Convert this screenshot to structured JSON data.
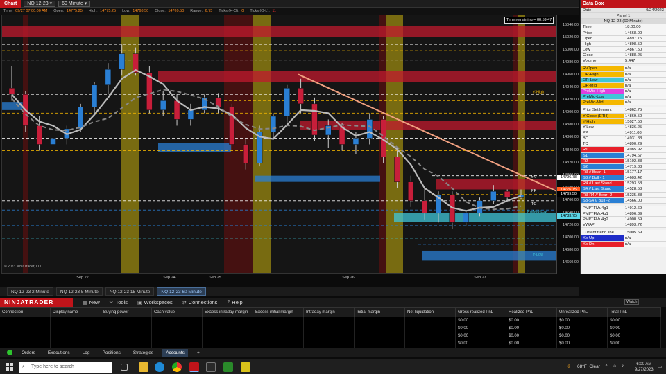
{
  "chart": {
    "window_label": "Chart",
    "instrument": "NQ 12-23",
    "interval": "60 Minute",
    "info": {
      "time_label": "Time",
      "time_value": "09/27 07:00:00 AM",
      "open_label": "Open",
      "open_value": "14775.25",
      "high_label": "High",
      "high_value": "14775.25",
      "low_label": "Low",
      "low_value": "14768.50",
      "close_label": "Close",
      "close_value": "14769.50",
      "range_label": "Range",
      "range_value": "6.75",
      "ticks_hl_label": "Ticks (H-O)",
      "ticks_hl_value": "0",
      "ticks_ol_label": "Ticks (O-L)",
      "ticks_ol_value": "11"
    },
    "time_remaining": "Time remaining = 00:59:47",
    "copyright": "© 2023 NinjaTrader, LLC",
    "overlay_labels": {
      "y_high": "Y-High",
      "bc": "BC",
      "pp": "PP",
      "tc": "TC",
      "prmid_low": "PreMid-Low",
      "y_low": "Y-Low"
    }
  },
  "chart_data": {
    "type": "candlestick",
    "title": "NQ 12-23 (60 Minute)",
    "ylim": [
      14660,
      15050
    ],
    "y_ticks": [
      15040,
      15020,
      15000,
      14980,
      14960,
      14940,
      14920,
      14900,
      14880,
      14860,
      14840,
      14820,
      14800,
      14780,
      14760,
      14740,
      14720,
      14700,
      14680,
      14660
    ],
    "y_tick_labels": [
      "15040.00",
      "15020.00",
      "15000.00",
      "14980.00",
      "14960.00",
      "14940.00",
      "14920.00",
      "14900.00",
      "14880.00",
      "14860.00",
      "14840.00",
      "14820.00",
      "14800.00",
      "14780.00",
      "14760.00",
      "14740.00",
      "14720.00",
      "14700.00",
      "14680.00",
      "14660.00"
    ],
    "x_ticks": [
      "Sep 22",
      "Sep 24",
      "Sep 25",
      "Sep 26",
      "Sep 27"
    ],
    "price_tags": [
      {
        "label": "14796.78",
        "value": 14796.78,
        "color": "#ffffff",
        "text": "#000000"
      },
      {
        "label": "14776.75",
        "value": 14776.75,
        "color": "#ff5a1f",
        "text": "#ffffff"
      },
      {
        "label": "14769.50",
        "value": 14769.5,
        "color": "#000000",
        "text": "#ffffff"
      },
      {
        "label": "14733.75",
        "value": 14733.75,
        "color": "#5bd6e8",
        "text": "#000000"
      }
    ],
    "zones": [
      {
        "name": "supply-top",
        "from": 15022,
        "to": 15040,
        "color": "#c01a2e"
      },
      {
        "name": "upper-supply",
        "from": 14950,
        "to": 14968,
        "color": "#c01a2e"
      },
      {
        "name": "mid-supply",
        "from": 14873,
        "to": 14888,
        "color": "#c01a2e"
      },
      {
        "name": "r-zone",
        "from": 14778,
        "to": 14794,
        "color": "#c01a2e"
      },
      {
        "name": "s-zone-blue",
        "from": 14664,
        "to": 14680,
        "color": "#2a7fd4"
      },
      {
        "name": "demand-blue-1",
        "from": 14905,
        "to": 14918,
        "color": "#2a7fd4"
      },
      {
        "name": "demand-blue-2",
        "from": 14838,
        "to": 14852,
        "color": "#2a7fd4"
      },
      {
        "name": "demand-blue-3",
        "from": 14790,
        "to": 14800,
        "color": "#2a7fd4"
      },
      {
        "name": "demand-cyan",
        "from": 14726,
        "to": 14740,
        "color": "#3fc6d8"
      }
    ],
    "session_bands_x_days": [
      0.4,
      2.4,
      3.4,
      4.7
    ],
    "series": [
      {
        "name": "Price",
        "candles": [
          [
            14940,
            14975,
            14920,
            14930
          ],
          [
            14930,
            14935,
            14870,
            14880
          ],
          [
            14880,
            14895,
            14840,
            14850
          ],
          [
            14850,
            14870,
            14835,
            14860
          ],
          [
            14860,
            14880,
            14850,
            14875
          ],
          [
            14875,
            14915,
            14870,
            14910
          ],
          [
            14910,
            14950,
            14900,
            14945
          ],
          [
            14945,
            14980,
            14930,
            14970
          ],
          [
            14970,
            15010,
            14960,
            14995
          ],
          [
            14995,
            15005,
            14960,
            14965
          ],
          [
            14965,
            14975,
            14900,
            14905
          ],
          [
            14905,
            14935,
            14895,
            14920
          ],
          [
            14920,
            14930,
            14880,
            14890
          ],
          [
            14890,
            14915,
            14880,
            14905
          ],
          [
            14905,
            14930,
            14900,
            14925
          ],
          [
            14925,
            14932,
            14900,
            14910
          ],
          [
            14910,
            14915,
            14840,
            14850
          ],
          [
            14850,
            14860,
            14810,
            14820
          ],
          [
            14820,
            14880,
            14815,
            14870
          ],
          [
            14870,
            14900,
            14860,
            14895
          ],
          [
            14895,
            14945,
            14885,
            14940
          ],
          [
            14940,
            14955,
            14900,
            14915
          ],
          [
            14915,
            14925,
            14855,
            14865
          ],
          [
            14865,
            14890,
            14845,
            14880
          ],
          [
            14880,
            14885,
            14840,
            14850
          ],
          [
            14850,
            14870,
            14835,
            14860
          ],
          [
            14860,
            14900,
            14850,
            14890
          ],
          [
            14890,
            14895,
            14820,
            14830
          ],
          [
            14830,
            14840,
            14780,
            14790
          ],
          [
            14790,
            14800,
            14750,
            14760
          ],
          [
            14760,
            14780,
            14730,
            14740
          ],
          [
            14740,
            14775,
            14725,
            14770
          ],
          [
            14770,
            14775,
            14715,
            14725
          ],
          [
            14725,
            14745,
            14720,
            14740
          ],
          [
            14740,
            14765,
            14735,
            14760
          ],
          [
            14760,
            14785,
            14755,
            14775
          ],
          [
            14775,
            14778,
            14760,
            14765
          ],
          [
            14765,
            14778,
            14762,
            14769.5
          ]
        ]
      }
    ]
  },
  "databox": {
    "title": "Data Box",
    "date_label": "Date",
    "date_value": "9/24/2023",
    "panel": "Panel 1",
    "instrument_header": "NQ 12-23 (60 Minute)",
    "rows_ohlc": [
      {
        "k": "Time",
        "v": "18:00:00"
      },
      {
        "k": "Price",
        "v": "14668.00"
      },
      {
        "k": "Open",
        "v": "14897.75"
      },
      {
        "k": "High",
        "v": "14898.50"
      },
      {
        "k": "Low",
        "v": "14867.50"
      },
      {
        "k": "Close",
        "v": "14888.25"
      },
      {
        "k": "Volume",
        "v": "5,447"
      }
    ],
    "rows_or": [
      {
        "k": "R-Open",
        "v": "n/a",
        "c": "#f5b800"
      },
      {
        "k": "OR-High",
        "v": "n/a",
        "c": "#f5b800"
      },
      {
        "k": "OR-Low",
        "v": "n/a",
        "c": "#3fc6d8"
      },
      {
        "k": "OR-Mid",
        "v": "n/a",
        "c": "#f5b800"
      },
      {
        "k": "PreMid-High",
        "v": "n/a",
        "c": "#e040e0"
      },
      {
        "k": "PreMid-Low",
        "v": "n/a",
        "c": "#3fc6d8"
      },
      {
        "k": "PreMid-Mid",
        "v": "n/a",
        "c": "#f5b800"
      }
    ],
    "rows_levels": [
      {
        "k": "Prior Settlement",
        "v": "14862.75",
        "c": "#f5f5f5"
      },
      {
        "k": "Y-Close (ETH)",
        "v": "14869.50",
        "c": "#f5b800"
      },
      {
        "k": "Y-High",
        "v": "15027.50",
        "c": "#f5b800"
      },
      {
        "k": "Y-Low",
        "v": "14836.25",
        "c": "#f5f5f5"
      },
      {
        "k": "PP",
        "v": "14911.08",
        "c": "#f5f5f5"
      },
      {
        "k": "BC",
        "v": "14931.88",
        "c": "#f5f5f5"
      },
      {
        "k": "TC",
        "v": "14890.29",
        "c": "#f5f5f5"
      },
      {
        "k": "R1",
        "v": "14985.92",
        "c": "#e8202a"
      },
      {
        "k": "S1",
        "v": "14794.67",
        "c": "#2a7fd4"
      },
      {
        "k": "R2",
        "v": "15102.33",
        "c": "#e8202a"
      },
      {
        "k": "S2",
        "v": "14719.83",
        "c": "#2a7fd4"
      },
      {
        "k": "R3 // Bear -1",
        "v": "15177.17",
        "c": "#e8202a"
      },
      {
        "k": "S3 // Bull - 1",
        "v": "14603.42",
        "c": "#2a7fd4"
      },
      {
        "k": "R4 // Last Stand",
        "v": "15293.58",
        "c": "#e8202a"
      },
      {
        "k": "S4 // Last Stand",
        "v": "14528.58",
        "c": "#2a7fd4"
      },
      {
        "k": "R3-R4 // Bear -2",
        "v": "15235.38",
        "c": "#e8202a"
      },
      {
        "k": "S3-S4 // Bull -2",
        "v": "14566.00",
        "c": "#2a7fd4"
      }
    ],
    "rows_misc": [
      {
        "k": "PMI/TFMu4g1",
        "v": "14912.69",
        "c": "#f5f5f5"
      },
      {
        "k": "PMI/TFMu4g1",
        "v": "14896.39",
        "c": "#f5f5f5"
      },
      {
        "k": "PMI/TFMu4g2",
        "v": "14900.59",
        "c": "#f5f5f5"
      },
      {
        "k": "VWAP",
        "v": "14893.72",
        "c": "#f5f5f5"
      }
    ],
    "rows_trend": [
      {
        "k": "Current trend line",
        "v": "15005.69",
        "c": "#f5f5f5"
      },
      {
        "k": "Xo-Up",
        "v": "n/a",
        "c": "#1e2cc8"
      },
      {
        "k": "Xo-Dn",
        "v": "n/a",
        "c": "#e8202a"
      }
    ]
  },
  "chart_tabs": [
    "NQ 12-23 2 Minute",
    "NQ 12-23 5 Minute",
    "NQ 12-23 15 Minute",
    "NQ 12-23 60 Minute"
  ],
  "control_center": {
    "logo": "NINJATRADER",
    "menu": [
      {
        "label": "New",
        "icon": "▦"
      },
      {
        "label": "Tools",
        "icon": "✂"
      },
      {
        "label": "Workspaces",
        "icon": "▣"
      },
      {
        "label": "Connections",
        "icon": "⇄"
      },
      {
        "label": "Help",
        "icon": "?"
      }
    ],
    "watch": "Watch",
    "grid_headers": [
      "Connection",
      "Display name",
      "Buying power",
      "Cash value",
      "Excess intraday margin",
      "Excess initial margin",
      "Intraday margin",
      "Initial margin",
      "Net liquidation",
      "Gross realized PnL",
      "Realized PnL",
      "Unrealized PnL",
      "Total PnL"
    ],
    "grid_rows": [
      [
        "",
        "",
        "",
        "",
        "",
        "",
        "",
        "",
        "",
        "$0.00",
        "$0.00",
        "$0.00",
        "$0.00"
      ],
      [
        "",
        "",
        "",
        "",
        "",
        "",
        "",
        "",
        "",
        "$0.00",
        "$0.00",
        "$0.00",
        "$0.00"
      ],
      [
        "",
        "",
        "",
        "",
        "",
        "",
        "",
        "",
        "",
        "$0.00",
        "$0.00",
        "$0.00",
        "$0.00"
      ],
      [
        "",
        "",
        "",
        "",
        "",
        "",
        "",
        "",
        "",
        "$0.00",
        "$0.00",
        "$0.00",
        "$0.00"
      ]
    ],
    "bottom_tabs": [
      "Orders",
      "Executions",
      "Log",
      "Positions",
      "Strategies",
      "Accounts"
    ],
    "add_tab": "+"
  },
  "taskbar": {
    "search_placeholder": "Type here to search",
    "weather": "68°F  Clear",
    "time": "6:00 AM",
    "date": "9/27/2023"
  }
}
